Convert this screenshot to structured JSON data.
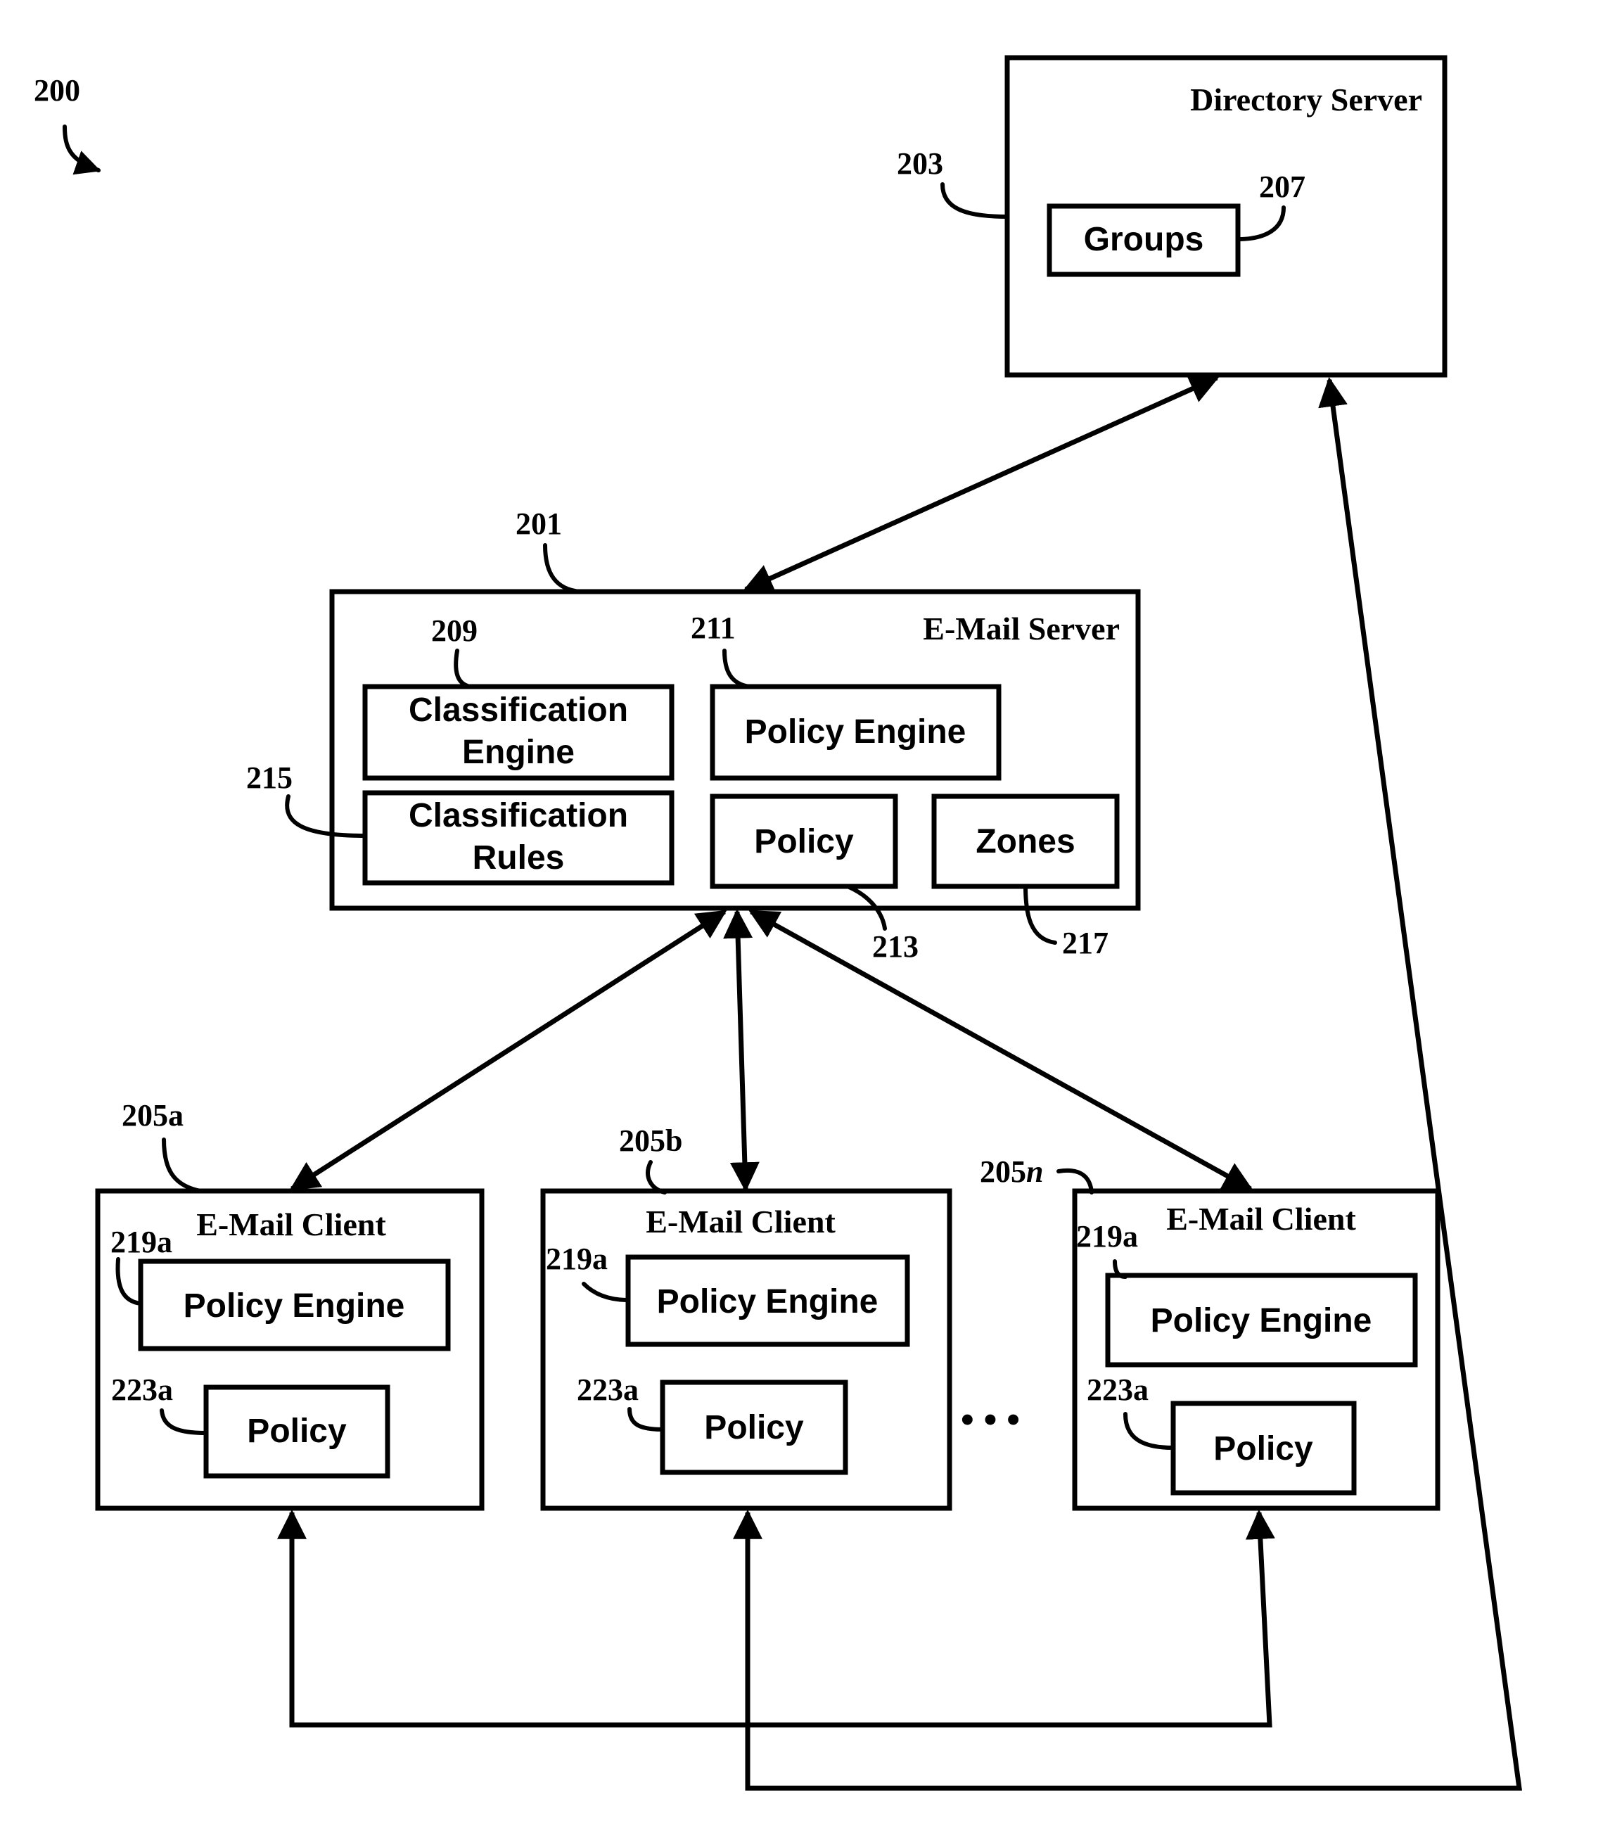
{
  "figure": {
    "ref": "200"
  },
  "directory_server": {
    "ref": "203",
    "title": "Directory Server",
    "groups": {
      "ref": "207",
      "label": "Groups"
    }
  },
  "email_server": {
    "ref": "201",
    "title": "E-Mail Server",
    "classification_engine": {
      "ref": "209",
      "line1": "Classification",
      "line2": "Engine"
    },
    "policy_engine": {
      "ref": "211",
      "label": "Policy Engine"
    },
    "classification_rules": {
      "ref": "215",
      "line1": "Classification",
      "line2": "Rules"
    },
    "policy": {
      "ref": "213",
      "label": "Policy"
    },
    "zones": {
      "ref": "217",
      "label": "Zones"
    }
  },
  "clients": [
    {
      "ref": "205a",
      "title": "E-Mail Client",
      "policy_engine_ref": "219a",
      "policy_engine_label": "Policy Engine",
      "policy_ref": "223a",
      "policy_label": "Policy"
    },
    {
      "ref": "205b",
      "title": "E-Mail Client",
      "policy_engine_ref": "219a",
      "policy_engine_label": "Policy Engine",
      "policy_ref": "223a",
      "policy_label": "Policy"
    },
    {
      "ref_prefix": "205",
      "ref_suffix": "n",
      "title": "E-Mail Client",
      "policy_engine_ref": "219a",
      "policy_engine_label": "Policy Engine",
      "policy_ref": "223a",
      "policy_label": "Policy"
    }
  ],
  "ellipsis": "• • •"
}
